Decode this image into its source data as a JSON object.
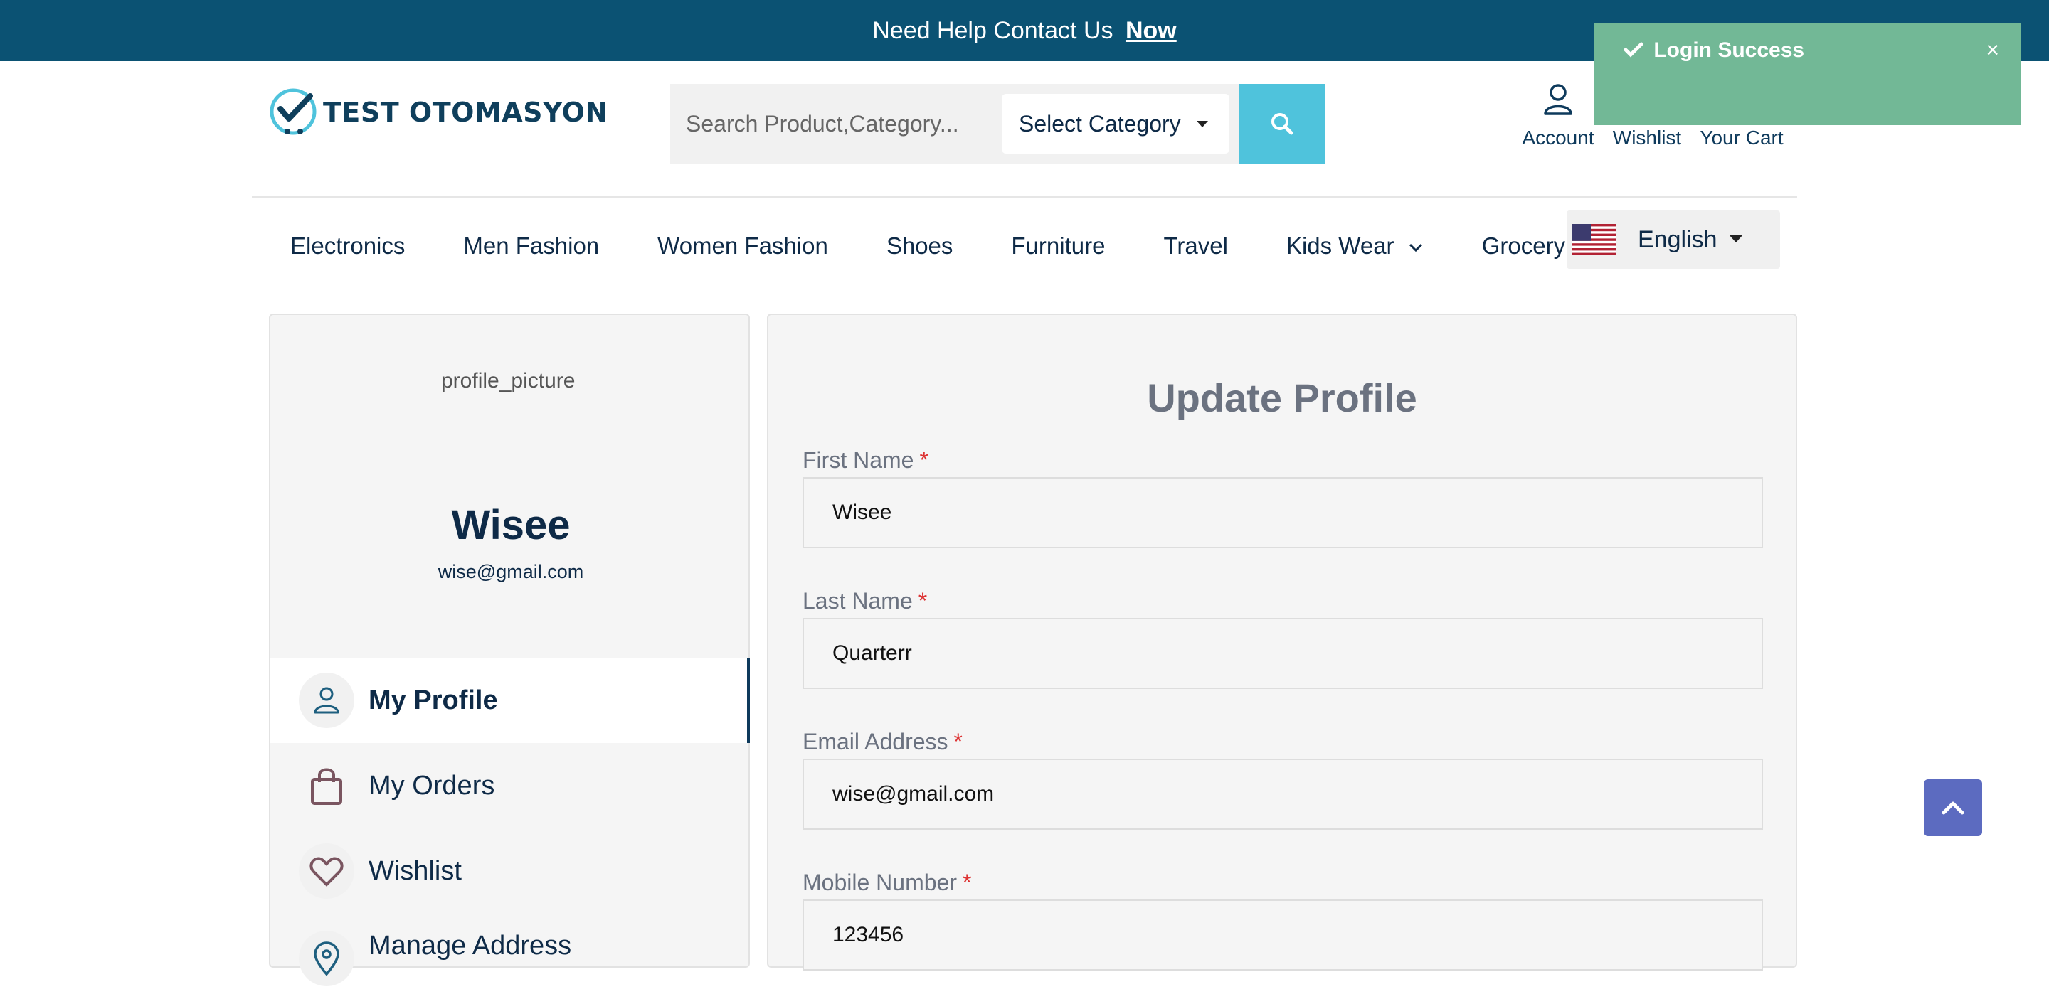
{
  "topbar": {
    "text": "Need Help Contact Us",
    "link": "Now"
  },
  "logo": {
    "text": "TEST OTOMASYON"
  },
  "search": {
    "placeholder": "Search Product,Category...",
    "category": "Select Category"
  },
  "header": {
    "account": "Account",
    "wishlist": "Wishlist",
    "cart": "Your Cart"
  },
  "nav": {
    "items": [
      "Electronics",
      "Men Fashion",
      "Women Fashion",
      "Shoes",
      "Furniture",
      "Travel",
      "Kids Wear",
      "Grocery"
    ],
    "language": "English"
  },
  "toast": {
    "message": "Login Success",
    "close": "×"
  },
  "profile": {
    "picture_alt": "profile_picture",
    "name": "Wisee",
    "email": "wise@gmail.com"
  },
  "sidebar": {
    "items": [
      "My Profile",
      "My Orders",
      "Wishlist",
      "Manage Address"
    ]
  },
  "form": {
    "title": "Update Profile",
    "first_name_label": "First Name",
    "first_name": "Wisee",
    "last_name_label": "Last Name",
    "last_name": "Quarterr",
    "email_label": "Email Address",
    "email": "wise@gmail.com",
    "mobile_label": "Mobile Number",
    "mobile": "123456",
    "required_mark": "*"
  },
  "colors": {
    "topbar": "#0b5273",
    "accent": "#4fc3dc",
    "toast": "#72b896",
    "scroll_button": "#5c6bc0"
  }
}
